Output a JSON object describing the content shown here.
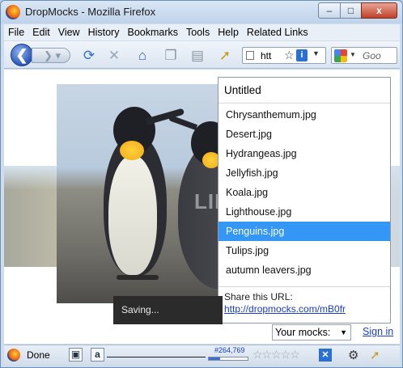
{
  "window": {
    "title": "DropMocks - Mozilla Firefox",
    "controls": {
      "minimize": "–",
      "maximize": "□",
      "close": "x"
    }
  },
  "menu": [
    {
      "label": "File"
    },
    {
      "label": "Edit"
    },
    {
      "label": "View"
    },
    {
      "label": "History"
    },
    {
      "label": "Bookmarks"
    },
    {
      "label": "Tools"
    },
    {
      "label": "Help"
    },
    {
      "label": "Related Links"
    }
  ],
  "navbar": {
    "back_glyph": "❮",
    "forward_glyph": "❯ ▾",
    "url_text": "htt",
    "url_info_glyph": "i",
    "search_placeholder": "Goo"
  },
  "album": {
    "title": "Untitled",
    "files": [
      {
        "name": "Chrysanthemum.jpg"
      },
      {
        "name": "Desert.jpg"
      },
      {
        "name": "Hydrangeas.jpg"
      },
      {
        "name": "Jellyfish.jpg"
      },
      {
        "name": "Koala.jpg"
      },
      {
        "name": "Lighthouse.jpg"
      },
      {
        "name": "Penguins.jpg"
      },
      {
        "name": "Tulips.jpg"
      },
      {
        "name": "autumn leavers.jpg"
      }
    ],
    "selected_file": "Penguins.jpg",
    "share_label": "Share this URL:",
    "share_url": "http://dropmocks.com/mB0fr"
  },
  "photo": {
    "watermark": "LIFEHACKER"
  },
  "toast": {
    "text": "Saving..."
  },
  "footer": {
    "mocks_select_value": "Your mocks:",
    "signin_label": "Sign in"
  },
  "statusbar": {
    "status_text": "Done",
    "alexa_rank": "#264,769",
    "rating_stars": "☆☆☆☆☆"
  },
  "colors": {
    "selection": "#3497f5",
    "link": "#1a3ccc",
    "toast_bg": "#2b2b2b"
  }
}
